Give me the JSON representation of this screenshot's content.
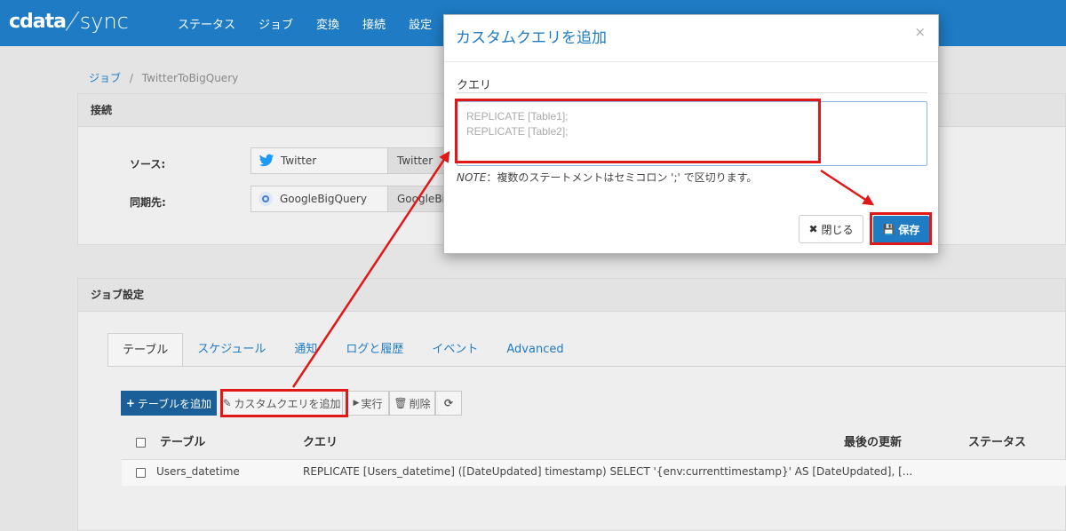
{
  "header": {
    "logo_left": "cdata",
    "logo_right": "sync",
    "nav": [
      "ステータス",
      "ジョブ",
      "変換",
      "接続",
      "設定"
    ]
  },
  "breadcrumb": {
    "root": "ジョブ",
    "sep": "/",
    "current": "TwitterToBigQuery"
  },
  "connection": {
    "title": "接続",
    "source_label": "ソース:",
    "source_name": "Twitter",
    "source_extra": "Twitter",
    "dest_label": "同期先:",
    "dest_name": "GoogleBigQuery",
    "dest_extra": "GoogleBig"
  },
  "job_settings": {
    "title": "ジョブ設定",
    "tabs": [
      "テーブル",
      "スケジュール",
      "通知",
      "ログと履歴",
      "イベント",
      "Advanced"
    ],
    "buttons": {
      "add_table": "テーブルを追加",
      "add_custom_query": "カスタムクエリを追加",
      "run": "実行",
      "delete": "削除"
    },
    "columns": [
      "テーブル",
      "クエリ",
      "最後の更新",
      "ステータス"
    ],
    "rows": [
      {
        "table": "Users_datetime",
        "query": "REPLICATE [Users_datetime] ([DateUpdated] timestamp) SELECT '{env:currenttimestamp}' AS [DateUpdated], [..."
      }
    ]
  },
  "modal": {
    "title": "カスタムクエリを追加",
    "close_glyph": "×",
    "field_label": "クエリ",
    "placeholder": "REPLICATE [Table1];\nREPLICATE [Table2];",
    "note_prefix": "NOTE",
    "note_text": "：複数のステートメントはセミコロン ';' で区切ります。",
    "close_button": "閉じる",
    "save_button": "保存"
  },
  "colors": {
    "brand": "#1e7bc4",
    "annotation": "#e01818"
  }
}
